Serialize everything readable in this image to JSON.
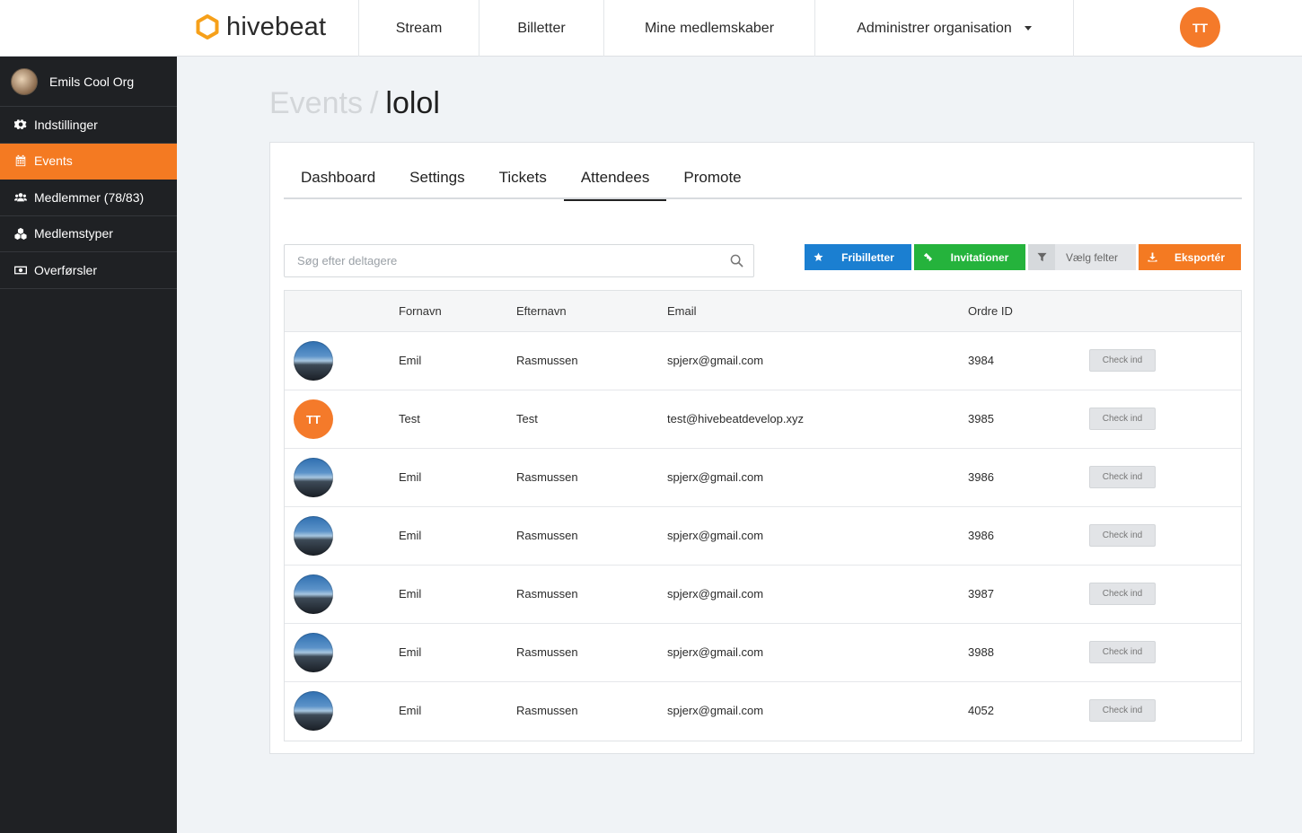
{
  "brand": {
    "name": "hivebeat",
    "accent": "#f47a22"
  },
  "topnav": {
    "items": [
      {
        "label": "Stream"
      },
      {
        "label": "Billetter"
      },
      {
        "label": "Mine medlemskaber"
      },
      {
        "label": "Administrer organisation"
      }
    ],
    "user_initials": "TT"
  },
  "sidebar": {
    "org_name": "Emils Cool Org",
    "items": [
      {
        "label": "Indstillinger",
        "icon": "gear-icon"
      },
      {
        "label": "Events",
        "icon": "calendar-icon",
        "active": true
      },
      {
        "label": "Medlemmer (78/83)",
        "icon": "users-icon"
      },
      {
        "label": "Medlemstyper",
        "icon": "cubes-icon"
      },
      {
        "label": "Overførsler",
        "icon": "money-icon"
      }
    ]
  },
  "breadcrumb": {
    "parent": "Events",
    "separator": "/",
    "current": "lolol"
  },
  "tabs": [
    {
      "label": "Dashboard"
    },
    {
      "label": "Settings"
    },
    {
      "label": "Tickets"
    },
    {
      "label": "Attendees",
      "active": true
    },
    {
      "label": "Promote"
    }
  ],
  "search": {
    "placeholder": "Søg efter deltagere",
    "value": ""
  },
  "actions": {
    "free_tickets": "Fribilletter",
    "invitations": "Invitationer",
    "choose_fields": "Vælg felter",
    "export": "Eksportér"
  },
  "table": {
    "columns": [
      "Fornavn",
      "Efternavn",
      "Email",
      "Ordre ID"
    ],
    "checkin_label": "Check ind",
    "rows": [
      {
        "avatar": "photo",
        "first": "Emil",
        "last": "Rasmussen",
        "email": "spjerx@gmail.com",
        "order": "3984"
      },
      {
        "avatar": "initials",
        "initials": "TT",
        "first": "Test",
        "last": "Test",
        "email": "test@hivebeatdevelop.xyz",
        "order": "3985"
      },
      {
        "avatar": "photo",
        "first": "Emil",
        "last": "Rasmussen",
        "email": "spjerx@gmail.com",
        "order": "3986"
      },
      {
        "avatar": "photo",
        "first": "Emil",
        "last": "Rasmussen",
        "email": "spjerx@gmail.com",
        "order": "3986"
      },
      {
        "avatar": "photo",
        "first": "Emil",
        "last": "Rasmussen",
        "email": "spjerx@gmail.com",
        "order": "3987"
      },
      {
        "avatar": "photo",
        "first": "Emil",
        "last": "Rasmussen",
        "email": "spjerx@gmail.com",
        "order": "3988"
      },
      {
        "avatar": "photo",
        "first": "Emil",
        "last": "Rasmussen",
        "email": "spjerx@gmail.com",
        "order": "4052"
      }
    ]
  }
}
